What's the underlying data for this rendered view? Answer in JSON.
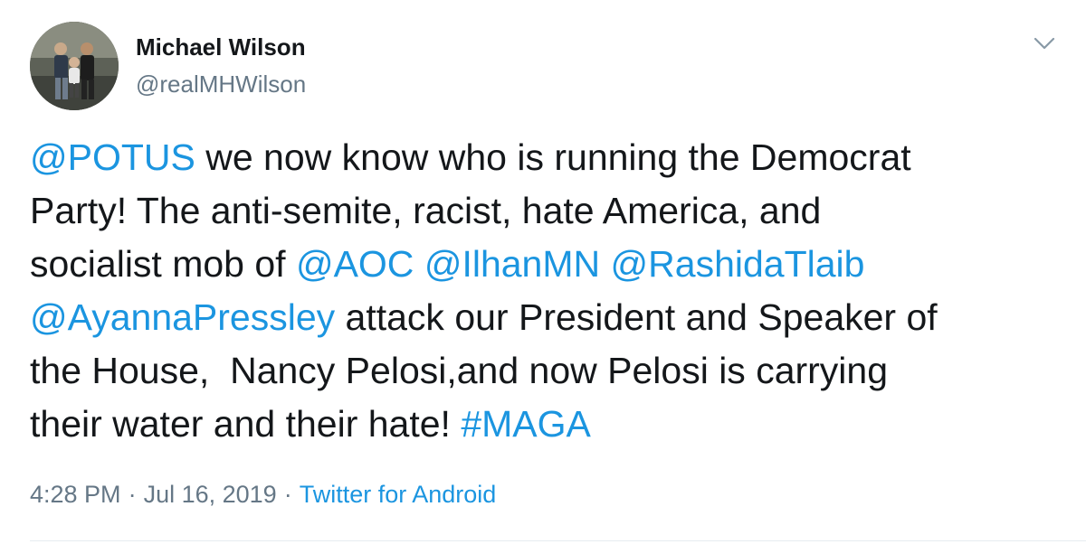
{
  "author": {
    "display_name": "Michael Wilson",
    "handle": "@realMHWilson"
  },
  "tweet": {
    "lines": [
      [
        {
          "t": "@POTUS",
          "k": "mention"
        },
        {
          "t": " we now know who is running the Democrat",
          "k": "text"
        }
      ],
      [
        {
          "t": "Party! The anti-semite, racist, hate America, and",
          "k": "text"
        }
      ],
      [
        {
          "t": "socialist mob of ",
          "k": "text"
        },
        {
          "t": "@AOC",
          "k": "mention"
        },
        {
          "t": " ",
          "k": "text"
        },
        {
          "t": "@IlhanMN",
          "k": "mention"
        },
        {
          "t": " ",
          "k": "text"
        },
        {
          "t": "@RashidaTlaib",
          "k": "mention"
        }
      ],
      [
        {
          "t": "@AyannaPressley",
          "k": "mention"
        },
        {
          "t": " attack our President and Speaker of",
          "k": "text"
        }
      ],
      [
        {
          "t": "the House,  Nancy Pelosi,and now Pelosi is carrying",
          "k": "text"
        }
      ],
      [
        {
          "t": "their water and their hate! ",
          "k": "text"
        },
        {
          "t": "#MAGA",
          "k": "hashtag"
        }
      ]
    ]
  },
  "meta": {
    "time": "4:28 PM",
    "separator": "·",
    "date": "Jul 16, 2019",
    "source": "Twitter for Android"
  },
  "icons": {
    "caret": "chevron-down-icon",
    "avatar": "avatar-photo"
  },
  "colors": {
    "link": "#1b95e0",
    "text": "#14171a",
    "muted": "#657786"
  }
}
